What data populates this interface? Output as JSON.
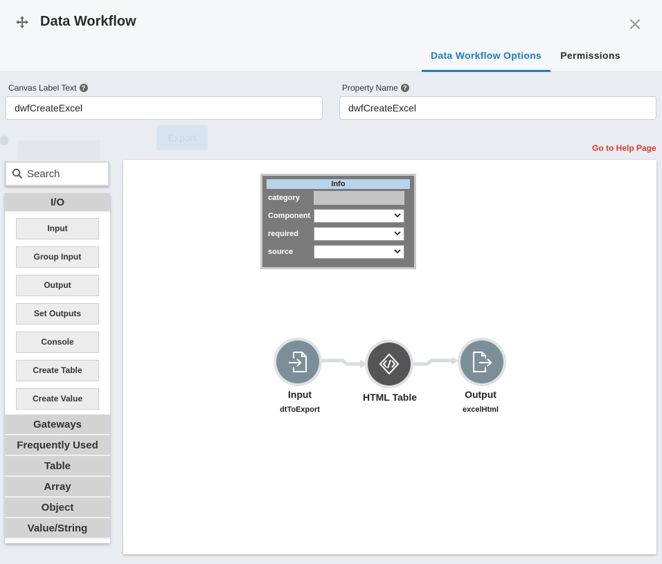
{
  "header": {
    "title": "Data Workflow",
    "tabs": [
      {
        "label": "Data Workflow Options",
        "active": true
      },
      {
        "label": "Permissions",
        "active": false
      }
    ]
  },
  "fields": {
    "canvas_label": {
      "label": "Canvas Label Text",
      "value": "dwfCreateExcel"
    },
    "property_name": {
      "label": "Property Name",
      "value": "dwfCreateExcel"
    }
  },
  "help_link": "Go to Help Page",
  "background": {
    "export_button": "Export"
  },
  "palette": {
    "search_placeholder": "Search",
    "io_category": "I/O",
    "io_items": [
      "Input",
      "Group Input",
      "Output",
      "Set Outputs",
      "Console",
      "Create Table",
      "Create Value"
    ],
    "categories": [
      "Gateways",
      "Frequently Used",
      "Table",
      "Array",
      "Object",
      "Value/String"
    ]
  },
  "info_panel": {
    "title": "Info",
    "rows": [
      {
        "key": "category",
        "value": ""
      },
      {
        "key": "Component",
        "value": ""
      },
      {
        "key": "required",
        "value": ""
      },
      {
        "key": "source",
        "value": ""
      }
    ]
  },
  "nodes": [
    {
      "label": "Input",
      "sublabel": "dtToExport",
      "icon": "file-import-icon"
    },
    {
      "label": "HTML Table",
      "sublabel": "",
      "icon": "code-icon"
    },
    {
      "label": "Output",
      "sublabel": "excelHtml",
      "icon": "file-export-icon"
    }
  ],
  "colors": {
    "accent": "#1a7fbf",
    "help_link": "#e0392b",
    "node": "#7c8f99",
    "node_dark": "#555555"
  }
}
